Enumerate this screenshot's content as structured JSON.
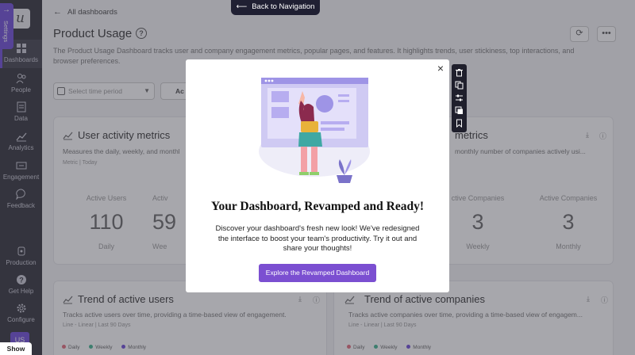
{
  "sidebar": {
    "logo": "u",
    "settings_label": "Settings",
    "items": [
      {
        "label": "Dashboards",
        "icon": "grid-icon"
      },
      {
        "label": "People",
        "icon": "people-icon"
      },
      {
        "label": "Data",
        "icon": "data-icon"
      },
      {
        "label": "Analytics",
        "icon": "analytics-icon"
      },
      {
        "label": "Engagement",
        "icon": "engagement-icon"
      },
      {
        "label": "Feedback",
        "icon": "feedback-icon"
      },
      {
        "label": "Production",
        "icon": "production-icon"
      },
      {
        "label": "Get Help",
        "icon": "help-icon"
      },
      {
        "label": "Configure",
        "icon": "gear-icon"
      }
    ],
    "avatar": "US",
    "show_label": "Show"
  },
  "header": {
    "breadcrumb": "All dashboards",
    "back_nav": "Back to Navigation",
    "title": "Product Usage",
    "description": "The Product Usage Dashboard tracks user and company engagement metrics, popular pages, and features. It highlights trends, user stickiness, top interactions, and browser preferences."
  },
  "filters": {
    "date_placeholder": "Select time period",
    "second_filter_partial": "Ac"
  },
  "cards": {
    "user_activity": {
      "title": "User activity metrics",
      "subtitle": "Measures the daily, weekly, and monthl",
      "meta": "Metric | Today",
      "metrics": [
        {
          "label": "Active Users",
          "value": "110",
          "period": "Daily"
        },
        {
          "label": "Activ",
          "value": "59",
          "period": "Wee"
        }
      ]
    },
    "company_activity": {
      "title_partial": "metrics",
      "subtitle_partial": "monthly number of companies actively usi...",
      "metrics": [
        {
          "label": "ctive Companies",
          "value": "3",
          "period": "Weekly"
        },
        {
          "label": "Active Companies",
          "value": "3",
          "period": "Monthly"
        }
      ]
    },
    "trend_users": {
      "title": "Trend of active users",
      "subtitle": "Tracks active users over time, providing a time-based view of engagement.",
      "meta": "Line - Linear | Last 90 Days",
      "legend": [
        "Daily",
        "Weekly",
        "Monthly"
      ]
    },
    "trend_companies": {
      "title": "Trend of active companies",
      "subtitle": "Tracks active companies over time, providing a time-based view of engagem...",
      "meta": "Line - Linear | Last 90 Days",
      "legend": [
        "Daily",
        "Weekly",
        "Monthly"
      ]
    }
  },
  "legend_colors": {
    "daily": "#e46b7a",
    "weekly": "#3fb58f",
    "monthly": "#6c4ad8"
  },
  "modal": {
    "title": "Your Dashboard, Revamped and Ready!",
    "body": "Discover your dashboard's fresh new look! We've redesigned the interface to boost your team's productivity. Try it out and share your thoughts!",
    "button": "Explore the Revamped Dashboard",
    "close_symbol": "×"
  },
  "toolbar": [
    "trash-icon",
    "copy-icon",
    "sliders-icon",
    "duplicate-icon",
    "bookmark-icon"
  ]
}
